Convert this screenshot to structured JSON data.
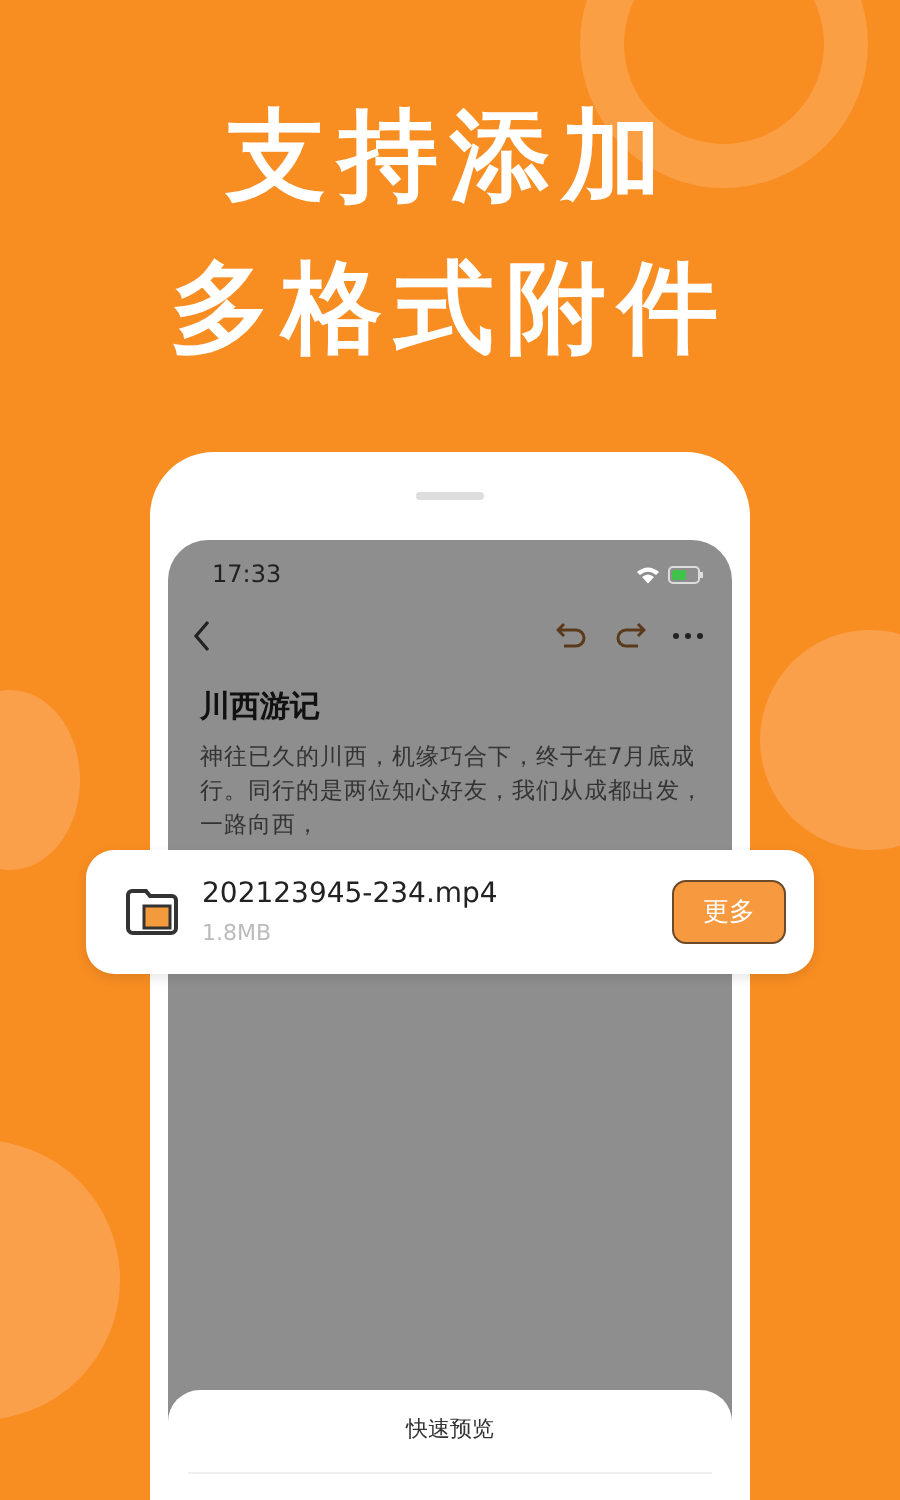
{
  "headline": [
    "支持添加",
    "多格式附件"
  ],
  "status_bar": {
    "time": "17:33"
  },
  "note": {
    "title": "川西游记",
    "body": "神往已久的川西，机缘巧合下，终于在7月底成行。同行的是两位知心好友，我们从成都出发，一路向西，"
  },
  "attachment": {
    "file_name": "202123945-234.mp4",
    "size": "1.8MB",
    "button": "更多"
  },
  "sheet": {
    "items": [
      "快速预览"
    ]
  }
}
